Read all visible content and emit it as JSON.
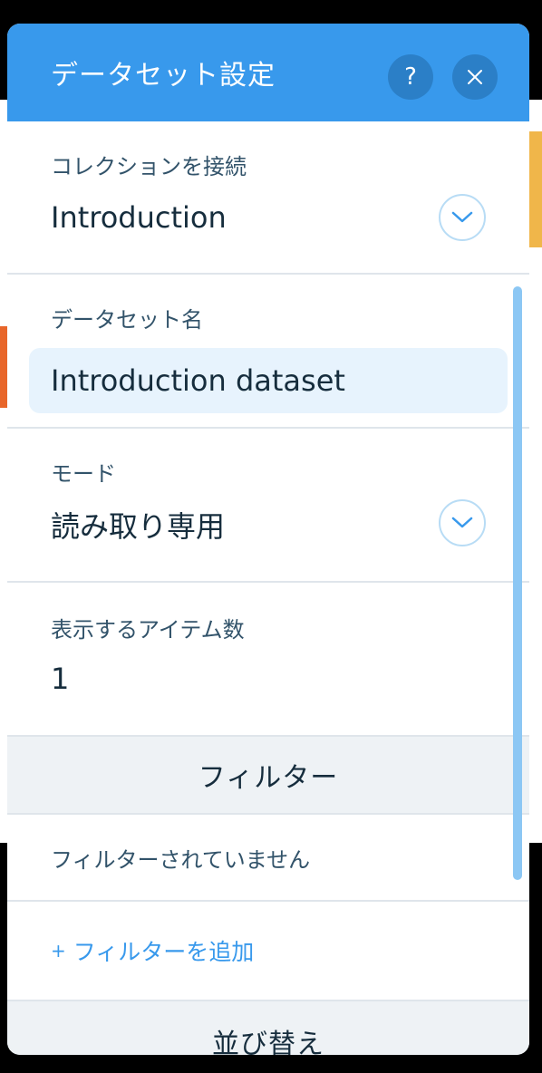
{
  "dialog": {
    "title": "データセット設定",
    "help_label": "?",
    "close_label": "✕"
  },
  "collection": {
    "label": "コレクションを接続",
    "value": "Introduction"
  },
  "dataset_name": {
    "label": "データセット名",
    "value": "Introduction dataset"
  },
  "mode": {
    "label": "モード",
    "value": "読み取り専用"
  },
  "items_count": {
    "label": "表示するアイテム数",
    "value": "1"
  },
  "filter": {
    "heading": "フィルター",
    "empty_text": "フィルターされていません",
    "add_plus": "+",
    "add_label": "フィルターを追加"
  },
  "sort": {
    "heading": "並び替え"
  },
  "colors": {
    "header": "#3899ec",
    "accent": "#3899ec",
    "input_bg": "#e7f3fd",
    "band_bg": "#eef2f5"
  }
}
